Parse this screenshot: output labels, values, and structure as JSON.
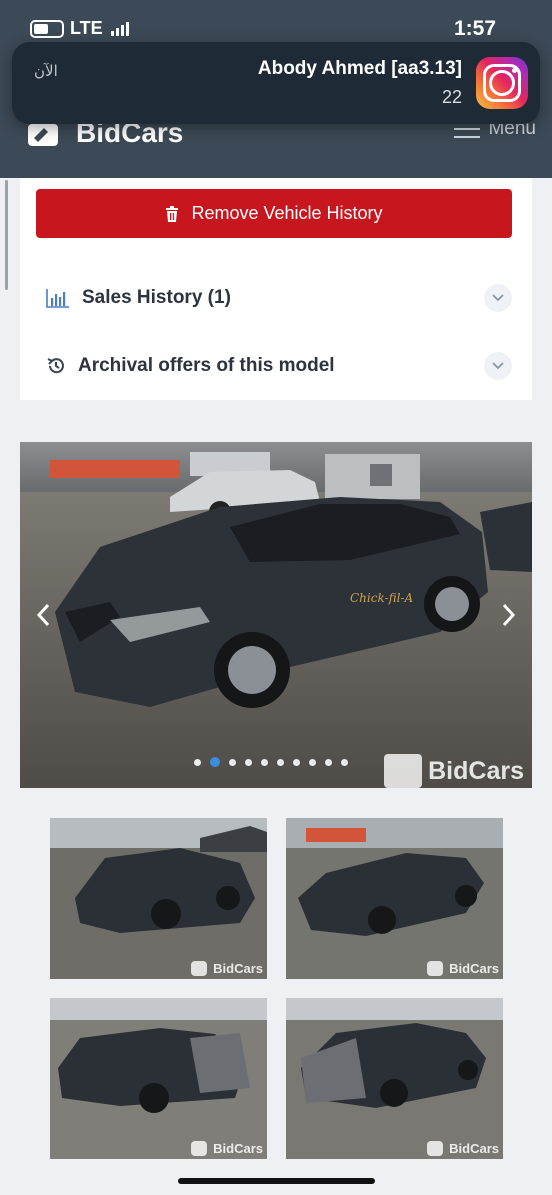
{
  "status_bar": {
    "network": "LTE",
    "time": "1:57"
  },
  "notification": {
    "time": "الآن",
    "title": "Abody Ahmed [aa3.13]",
    "count": "22",
    "app_icon": "instagram-icon"
  },
  "header": {
    "brand": "BidCars",
    "menu_label": "Menu"
  },
  "actions": {
    "remove_history_label": "Remove Vehicle History",
    "remove_icon": "trash-icon"
  },
  "accordions": [
    {
      "label": "Sales History (1)",
      "icon": "bar-chart-icon"
    },
    {
      "label": "Archival offers of this model",
      "icon": "history-icon"
    }
  ],
  "gallery": {
    "watermark": "BidCars",
    "total_photos": 10,
    "active_photo_index": 1,
    "thumb_watermark": "BidCars"
  },
  "colors": {
    "header_bg": "#3c4956",
    "danger": "#c8161e",
    "active_dot": "#3b8de0"
  }
}
